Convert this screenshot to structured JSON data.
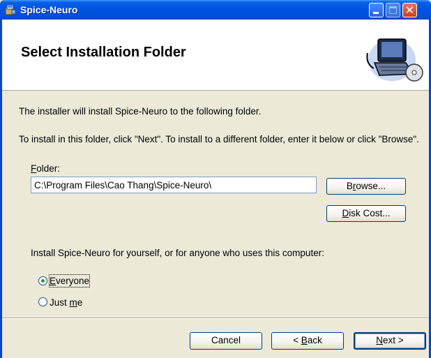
{
  "window": {
    "title": "Spice-Neuro",
    "app_icon": "installer-package-icon",
    "controls": {
      "minimize": "minimize-icon",
      "maximize": "maximize-icon",
      "close_glyph": "✕"
    }
  },
  "header": {
    "title": "Select Installation Folder",
    "art_icon": "computer-with-cd-icon"
  },
  "body": {
    "intro": "The installer will install Spice-Neuro to the following folder.",
    "instructions": "To install in this folder, click \"Next\". To install to a different folder, enter it below or click \"Browse\".",
    "folder_label_first": "F",
    "folder_label_rest": "older:",
    "folder_value": "C:\\Program Files\\Cao Thang\\Spice-Neuro\\",
    "browse": {
      "pre": "B",
      "mn": "r",
      "post": "owse..."
    },
    "disk_cost": {
      "pre": "",
      "mn": "D",
      "post": "isk Cost..."
    },
    "install_for": "Install Spice-Neuro for yourself, or for anyone who uses this computer:",
    "options": [
      {
        "pre": "",
        "mn": "E",
        "post": "veryone",
        "selected": true
      },
      {
        "pre": "Just ",
        "mn": "m",
        "post": "e",
        "selected": false
      }
    ]
  },
  "footer": {
    "cancel": "Cancel",
    "back": {
      "pre": "< ",
      "mn": "B",
      "post": "ack"
    },
    "next": {
      "pre": "",
      "mn": "N",
      "post": "ext >"
    }
  },
  "colors": {
    "titlebar": "#0054e3",
    "dialog_bg": "#ece9d8",
    "selected_radio": "#2b9b32"
  }
}
